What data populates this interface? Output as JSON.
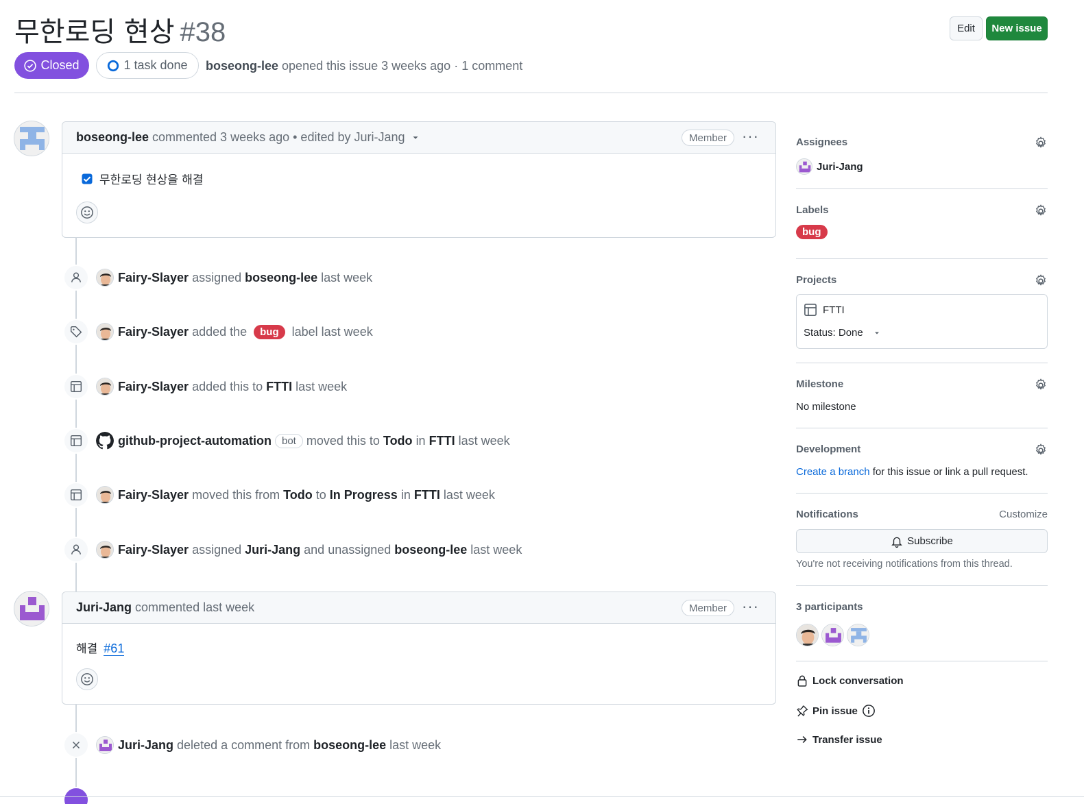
{
  "issue": {
    "title": "무한로딩 현상",
    "number": "#38",
    "state": "Closed",
    "tasks": "1 task done",
    "author": "boseong-lee",
    "meta_text": "opened this issue 3 weeks ago · 1 comment"
  },
  "header": {
    "edit_label": "Edit",
    "new_issue_label": "New issue"
  },
  "comments": [
    {
      "author": "boseong-lee",
      "meta": "commented 3 weeks ago • edited by Juri-Jang",
      "role": "Member",
      "task_text": "무한로딩 현상을 해결"
    },
    {
      "author": "Juri-Jang",
      "meta": "commented last week",
      "role": "Member",
      "body_text": "해결",
      "body_link": "#61"
    }
  ],
  "timeline": {
    "e1": {
      "actor": "Fairy-Slayer",
      "t1": "assigned",
      "target": "boseong-lee",
      "time": "last week"
    },
    "e2": {
      "actor": "Fairy-Slayer",
      "t1": "added the",
      "label": "bug",
      "t2": "label last week"
    },
    "e3": {
      "actor": "Fairy-Slayer",
      "t1": "added this to",
      "project": "FTTI",
      "time": "last week"
    },
    "e4": {
      "actor": "github-project-automation",
      "bot": "bot",
      "t1": "moved this to",
      "status": "Todo",
      "t2": "in",
      "project": "FTTI",
      "time": "last week"
    },
    "e5": {
      "actor": "Fairy-Slayer",
      "t1": "moved this from",
      "from": "Todo",
      "t2": "to",
      "to": "In Progress",
      "t3": "in",
      "project": "FTTI",
      "time": "last week"
    },
    "e6": {
      "actor": "Fairy-Slayer",
      "t1": "assigned",
      "target": "Juri-Jang",
      "t2": "and unassigned",
      "target2": "boseong-lee",
      "time": "last week"
    },
    "e7": {
      "actor": "Juri-Jang",
      "t1": "deleted a comment from",
      "target": "boseong-lee",
      "time": "last week"
    }
  },
  "sidebar": {
    "assignees": {
      "title": "Assignees",
      "user": "Juri-Jang"
    },
    "labels": {
      "title": "Labels",
      "label": "bug"
    },
    "projects": {
      "title": "Projects",
      "name": "FTTI",
      "status": "Status: Done"
    },
    "milestone": {
      "title": "Milestone",
      "value": "No milestone"
    },
    "development": {
      "title": "Development",
      "link": "Create a branch",
      "text": "for this issue or link a pull request."
    },
    "notifications": {
      "title": "Notifications",
      "customize": "Customize",
      "subscribe": "Subscribe",
      "note": "You're not receiving notifications from this thread."
    },
    "participants": {
      "title": "3 participants"
    },
    "actions": {
      "lock": "Lock conversation",
      "pin": "Pin issue",
      "transfer": "Transfer issue"
    }
  },
  "colors": {
    "closed": "#8250df",
    "green": "#1f883d",
    "bug": "#d73a4a",
    "link": "#0969da"
  }
}
